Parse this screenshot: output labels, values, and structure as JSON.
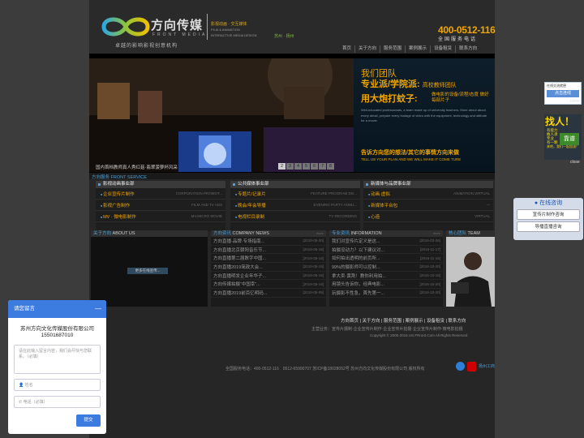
{
  "header": {
    "logo_cn": "方向传媒",
    "logo_en": "FRONT MEDIA",
    "slogan": "卓越的影响影视创意机构",
    "tag1": "影视动画 · 交互媒体",
    "tag2": "FILM & ANIMATION",
    "tag3": "INTERACTIVE MEDIA DESIGN",
    "tag4": "苏州 · 扬州",
    "phone": "400-0512-116",
    "phone_sub": "全国服务电话"
  },
  "nav": [
    "首页",
    "关于方向",
    "服务范围",
    "案例展示",
    "设备租赁",
    "联系方向"
  ],
  "banner": {
    "t1": "我们团队",
    "t2": "专业派/学院派:",
    "t2_small": "高校教师团队",
    "t3": "用大炮打蚊子:",
    "t3_side": "做电影的设备/流程/态度 做好每部片子",
    "en": "Well-educated professionals, a team made up of university teachers. More about about every detail, prepare every footage of video with the equipment, technology and attitude for a movie.",
    "ask": "告诉方向您的想法/其它的事情方向来做",
    "ask_en": "TELL US YOUR PLAN AND WE WILL MAKE IT COME TURE",
    "caption": "国内首档教师真人秀红菇·翡翠菠萝杯风采",
    "pages": [
      "2",
      "3",
      "4",
      "5",
      "6",
      "7",
      "8"
    ]
  },
  "services": {
    "title": "方向服务 FRONT SERVICE",
    "columns": [
      {
        "head": "影视动画事业部",
        "items": [
          {
            "zh": "企业宣传片制作",
            "en": "CORPORATION PROMOT..."
          },
          {
            "zh": "影视广告制作",
            "en": "FILM AND TV ADS"
          },
          {
            "zh": "MV · 微电影制作",
            "en": "MV,MICRO MOVIE"
          }
        ]
      },
      {
        "head": "公共媒体事业部",
        "items": [
          {
            "zh": "专题片/记录片",
            "en": "FEATURE PROGRAM DO..."
          },
          {
            "zh": "晚会/年会导播",
            "en": "EVENING PARTY ANNU..."
          },
          {
            "zh": "电视栏目录制",
            "en": "TV RECORDING"
          }
        ]
      },
      {
        "head": "新媒体与品牌事业部",
        "items": [
          {
            "zh": "动画·虚拟",
            "en": "ANIMATION,VIRTUAL"
          },
          {
            "zh": "新媒体平台包",
            "en": "—"
          },
          {
            "zh": "心造",
            "en": "VIRTUAL"
          }
        ]
      }
    ]
  },
  "about": {
    "title": "关于方向",
    "title_en": "ABOUT US",
    "btn": "更多在线宣传..."
  },
  "company_news": {
    "title": "方向资讯",
    "title_en": "COMPANY NEWS",
    "more": "more",
    "items": [
      {
        "t": "方向直播·品牌·专场指南...",
        "d": "[2019-05-30]"
      },
      {
        "t": "方向直播北京朝阳音乐节...",
        "d": "[2019-05-19]"
      },
      {
        "t": "方向直播第二届数字中国...",
        "d": "[2019-05-19]"
      },
      {
        "t": "方向直播2019简政大会...",
        "d": "[2019-05-19]"
      },
      {
        "t": "方向直播明发企业年华子...",
        "d": "[2019-05-19]"
      },
      {
        "t": "方向传媒拍摄“中国幸”...",
        "d": "[2019-05-19]"
      },
      {
        "t": "方向直播2019前百亿明码...",
        "d": "[2019-05-09]"
      }
    ]
  },
  "info": {
    "title": "专业资讯",
    "title_en": "INFORMATION",
    "more": "more",
    "items": [
      {
        "t": "我们对宣传片定义是这...",
        "d": "[2016-03-26]"
      },
      {
        "t": "拍摄没动力？以下建议对...",
        "d": "[2016-11-17]"
      },
      {
        "t": "如何拍出透明的前页所...",
        "d": "[2016-11-15]"
      },
      {
        "t": "99%的摄影师可以控制...",
        "d": "[2016-10-20]"
      },
      {
        "t": "拿大卖·黄荆！教你利用拍...",
        "d": "[2016-10-18]"
      },
      {
        "t": "用镜头告诉你，经典电影...",
        "d": "[2016-10-20]"
      },
      {
        "t": "玩摄影不性急，首先第一...",
        "d": "[2016-10-20]"
      }
    ]
  },
  "team": {
    "title": "核心团队",
    "title_en": "TEAM"
  },
  "footer": {
    "nav": "方向首页 | 关于方向 | 服务范围 | 案例展示 | 设备租赁 | 联系方向",
    "line2": "主营业务：宣传片摄制·企业宣传片制作·企业宣传片拍摄·企业宣传片制作·微电影拍摄",
    "line3": "Copyright © 2006-2015 US.FRront.Com All Rights Reserved",
    "line4": "全国服务电话：400-0512-116　0512-65990707 苏ICP备18028052号 苏州方向文化传媒股份有限公司 版权所有",
    "badge": "扬州工商"
  },
  "float": {
    "qq_title": "在线交流就便",
    "qq_btn": "点击连线",
    "close": "close",
    "recruit_big": "找人！",
    "recruit_lines": [
      "有能力",
      "敢人承",
      "专业",
      "有一颗",
      "卓",
      "事业心",
      "宣的"
    ],
    "recruit_mid": "靠谱",
    "recruit_foot": "来吧，我们一起加油！"
  },
  "consult": {
    "head": "在线咨询",
    "items": [
      "宣传片制作咨询",
      "导播直播咨询"
    ]
  },
  "msg": {
    "head": "请您留言",
    "company": "苏州方向文化传媒股份有限公司",
    "phone": "15501687010",
    "ta_ph": "请在此输入留言内容，我们会尽快与您联系。（必填）",
    "name_ph": "姓名",
    "tel_ph": "电话（必填）",
    "submit": "提交"
  },
  "colors": {
    "accent": "#f0a500",
    "blue": "#4aa0d8",
    "widget": "#3c7be0"
  }
}
